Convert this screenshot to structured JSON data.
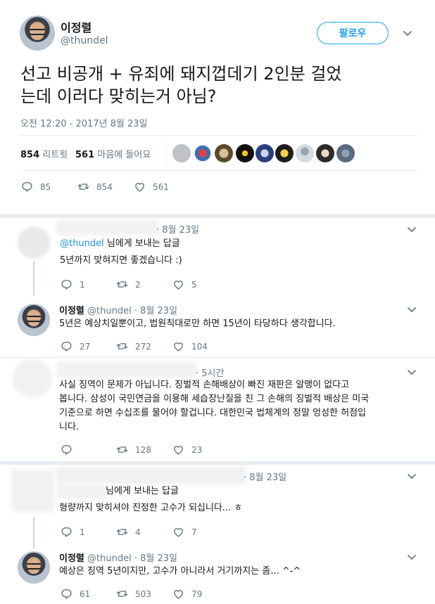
{
  "main_tweet": {
    "name": "이정렬",
    "handle": "@thundel",
    "follow_label": "팔로우",
    "text_line1": "선고 비공개 + 유죄에 돼지껍데기 2인분 걸었",
    "text_line2": "는데 이러다 맞히는거 아님?",
    "timestamp": "오전 12:20 - 2017년 8월 23일",
    "retweet_count": "854",
    "retweet_label": "리트윗",
    "like_count": "561",
    "like_label": "마음에 들어요",
    "actions": {
      "reply": "85",
      "retweet": "854",
      "like": "561"
    }
  },
  "replies": [
    {
      "name": "",
      "handle": "",
      "time": "· 8월 23일",
      "reply_to_handle": "@thundel",
      "reply_to_suffix": " 님에게 보내는 답글",
      "text": "5년까지 맞혀지면 좋겠습니다 :)",
      "actions": {
        "reply": "1",
        "retweet": "2",
        "like": "5"
      }
    },
    {
      "name": "이정렬",
      "handle": "@thundel",
      "time": "· 8월 23일",
      "text": "5년은 예상치일뿐이고, 법원칙대로만 하면 15년이 타당하다 생각합니다.",
      "actions": {
        "reply": "27",
        "retweet": "272",
        "like": "104"
      }
    },
    {
      "name": "",
      "handle": "",
      "time": "· 5시간",
      "text_lines": [
        "사실 징역이 문제가 아닙니다. 징벌적 손해배상이 빠진 재판은 알맹이 없다고",
        "봅니다. 삼성이 국민연금을 이용해 세습장난질을 친 그 손해의 징벌적 배상은 미국",
        "기준으로 하면 수십조를 물어야 할겁니다. 대한민국 법체계의 정말 엉성한 허점입",
        "니다."
      ],
      "actions": {
        "reply": "",
        "retweet": "128",
        "like": "23"
      }
    },
    {
      "name": "",
      "handle": "",
      "time": "· 8월 23일",
      "reply_to_suffix": "님에게 보내는 답글",
      "text": "형량까지 맞히셔야 진정한 고수가 되십니다... ㅎ",
      "actions": {
        "reply": "1",
        "retweet": "4",
        "like": "7"
      }
    },
    {
      "name": "이정렬",
      "handle": "@thundel",
      "time": "· 8월 23일",
      "text": "예상은 징역 5년이지만, 고수가 아니라서 거기까지는 좀... ^-^",
      "actions": {
        "reply": "61",
        "retweet": "503",
        "like": "79"
      }
    }
  ],
  "colors": {
    "accent": "#1da1f2",
    "muted": "#657786",
    "divider": "#e6ecf0"
  }
}
